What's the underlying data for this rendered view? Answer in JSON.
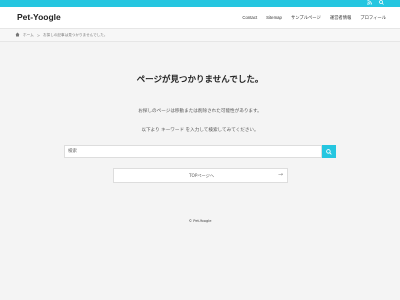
{
  "topbar": {
    "icons": [
      "rss-icon",
      "search-icon"
    ],
    "accent": "#25c6e0"
  },
  "header": {
    "logo": "Pet-Yoogle",
    "nav": [
      "Contact",
      "Sitemap",
      "サンプルページ",
      "運営者情報",
      "プロフィール"
    ]
  },
  "breadcrumb": {
    "home": "ホーム",
    "separator": ">",
    "current": "お探しの記事は見つかりませんでした。"
  },
  "main": {
    "title": "ページが見つかりませんでした。",
    "message1": "お探しのページは移動または削除された可能性があります。",
    "message2": "以下より キーワード を入力して検索してみてください。",
    "search_placeholder": "検索",
    "top_button": "TOPページへ",
    "top_button_arrow": "→"
  },
  "footer": {
    "copyright": "© Pet-Yoogle"
  }
}
